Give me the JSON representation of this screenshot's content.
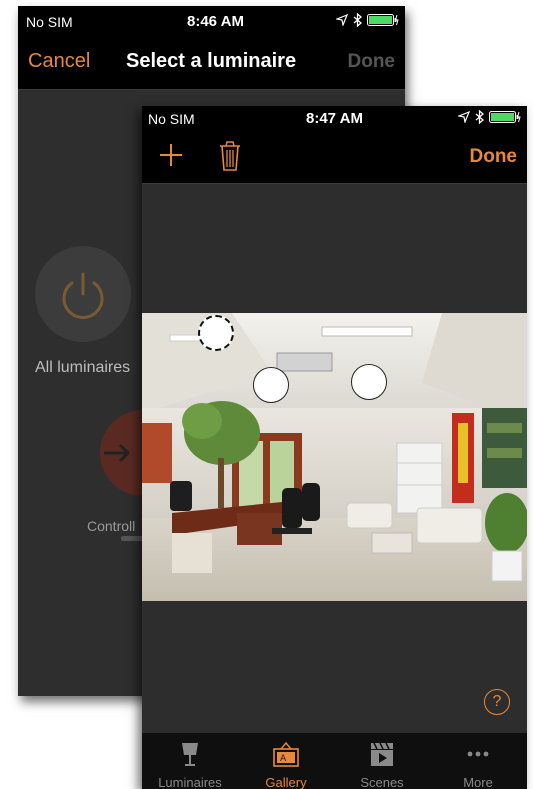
{
  "colors": {
    "accent": "#e8883a",
    "background": "#2d2d2d",
    "bar": "#000000"
  },
  "back_screen": {
    "status": {
      "carrier": "No SIM",
      "time": "8:46 AM"
    },
    "nav": {
      "cancel": "Cancel",
      "title": "Select a luminaire",
      "done": "Done"
    },
    "all_luminaires_label": "All luminaires",
    "controller_label": "Controll"
  },
  "front_screen": {
    "status": {
      "carrier": "No SIM",
      "time": "8:47 AM"
    },
    "nav": {
      "add_icon": "plus-icon",
      "delete_icon": "trash-icon",
      "done": "Done"
    },
    "photo": {
      "description_icon": "office-room-photo",
      "markers": [
        {
          "id": "marker-1",
          "style": "dashed"
        },
        {
          "id": "marker-2",
          "style": "solid"
        },
        {
          "id": "marker-3",
          "style": "solid"
        }
      ]
    },
    "help": "?",
    "tabs": [
      {
        "label": "Luminaires",
        "icon": "lamp-icon",
        "active": false
      },
      {
        "label": "Gallery",
        "icon": "gallery-icon",
        "active": true
      },
      {
        "label": "Scenes",
        "icon": "clapper-icon",
        "active": false
      },
      {
        "label": "More",
        "icon": "more-icon",
        "active": false
      }
    ]
  }
}
